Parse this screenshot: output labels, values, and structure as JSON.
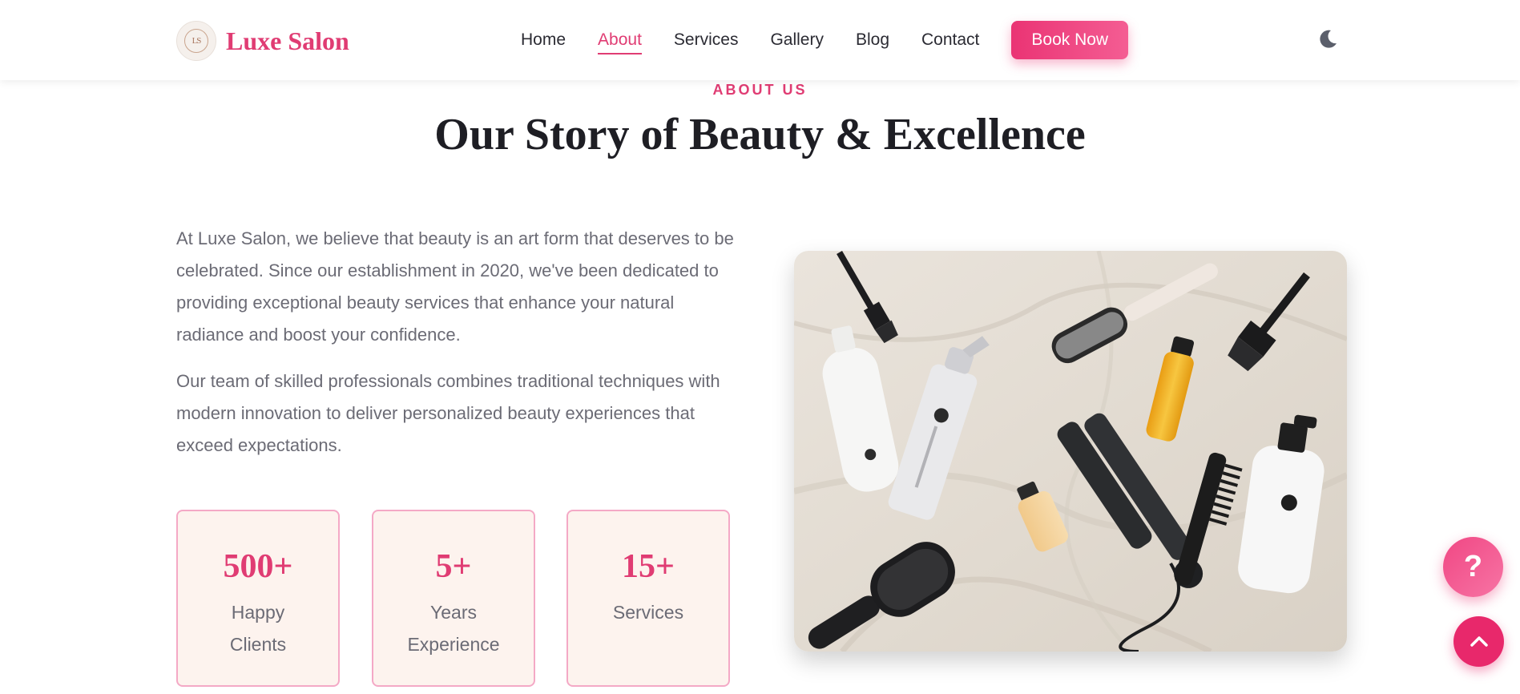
{
  "header": {
    "logo_mark": "LS",
    "brand": "Luxe Salon",
    "nav": [
      {
        "label": "Home",
        "active": false
      },
      {
        "label": "About",
        "active": true
      },
      {
        "label": "Services",
        "active": false
      },
      {
        "label": "Gallery",
        "active": false
      },
      {
        "label": "Blog",
        "active": false
      },
      {
        "label": "Contact",
        "active": false
      }
    ],
    "cta_label": "Book Now",
    "theme_icon": "moon-icon"
  },
  "about": {
    "eyebrow": "ABOUT US",
    "title": "Our Story of Beauty & Excellence",
    "paragraphs": [
      "At Luxe Salon, we believe that beauty is an art form that deserves to be celebrated. Since our establishment in 2020, we've been dedicated to providing exceptional beauty services that enhance your natural radiance and boost your confidence.",
      "Our team of skilled professionals combines traditional techniques with modern innovation to deliver personalized beauty experiences that exceed expectations."
    ],
    "stats": [
      {
        "value": "500+",
        "label": "Happy Clients"
      },
      {
        "value": "5+",
        "label": "Years Experience"
      },
      {
        "value": "15+",
        "label": "Services"
      }
    ]
  },
  "floating": {
    "help_label": "?",
    "help_icon": "question-icon",
    "top_icon": "chevron-up-icon"
  },
  "colors": {
    "accent": "#e03c73",
    "card_bg": "#fdf3ee",
    "card_border": "#f4a9c6",
    "text_muted": "#6b6b75"
  }
}
